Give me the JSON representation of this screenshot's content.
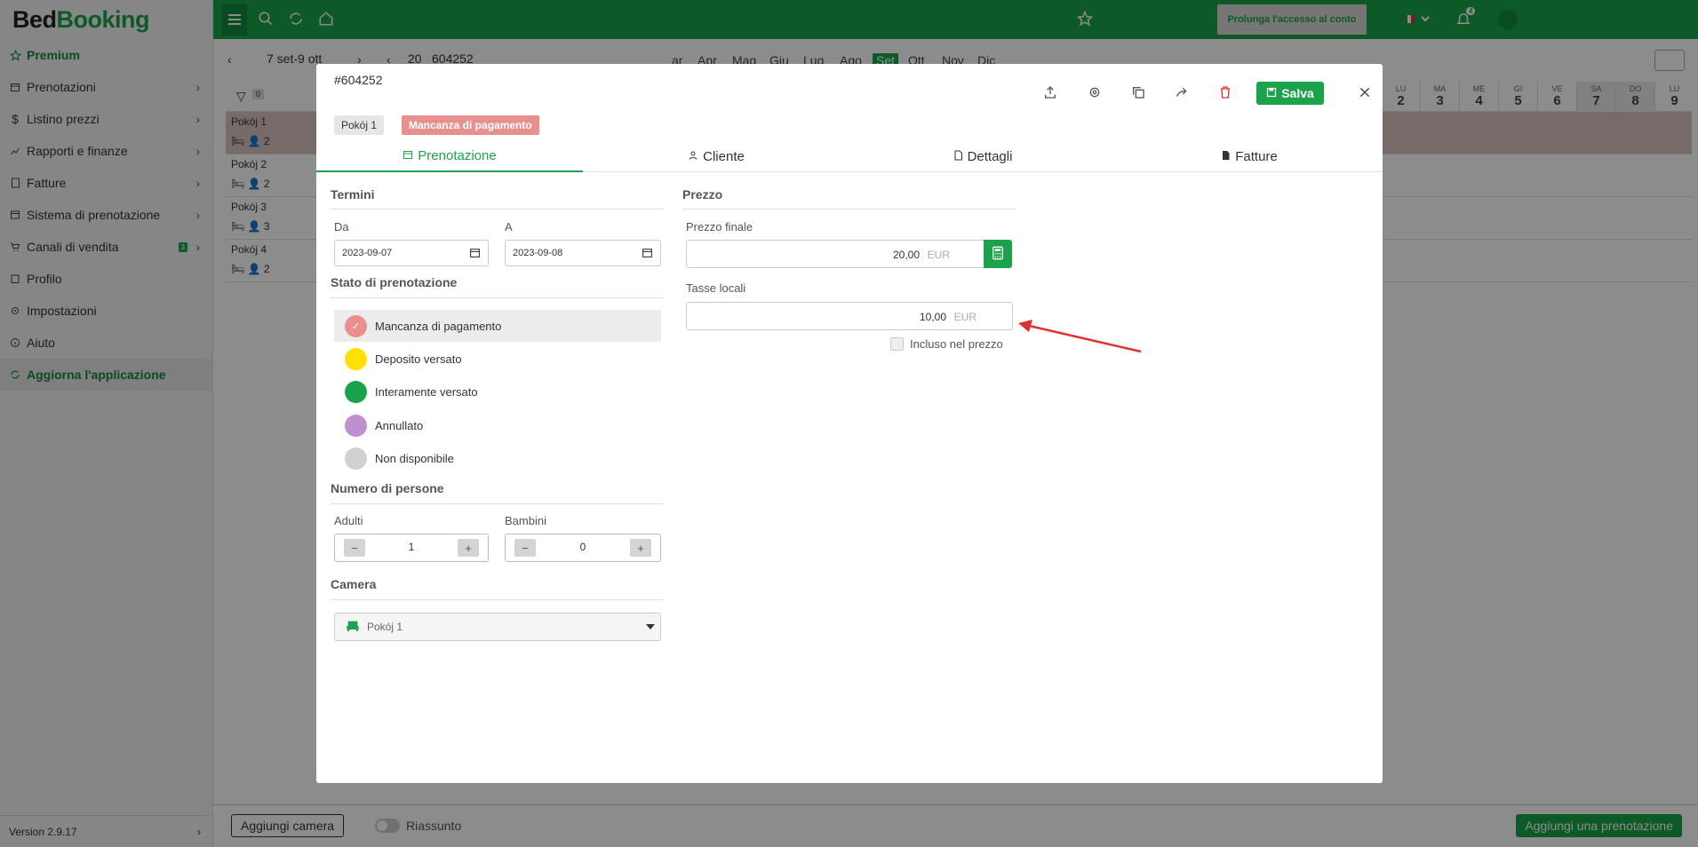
{
  "app": {
    "logo_bed": "Bed",
    "logo_booking": "Booking",
    "version": "Version 2.9.17"
  },
  "sidebar": {
    "items": [
      {
        "label": "Premium",
        "icon": "star-icon"
      },
      {
        "label": "Prenotazioni",
        "icon": "calendar-icon"
      },
      {
        "label": "Listino prezzi",
        "icon": "dollar-icon"
      },
      {
        "label": "Rapporti e finanze",
        "icon": "chart-icon"
      },
      {
        "label": "Fatture",
        "icon": "invoice-icon"
      },
      {
        "label": "Sistema di prenotazione",
        "icon": "window-icon"
      },
      {
        "label": "Canali di vendita",
        "icon": "cart-icon",
        "badge": "3"
      },
      {
        "label": "Profilo",
        "icon": "building-icon"
      },
      {
        "label": "Impostazioni",
        "icon": "gear-icon"
      },
      {
        "label": "Aiuto",
        "icon": "info-icon"
      },
      {
        "label": "Aggiorna l'applicazione",
        "icon": "refresh-icon"
      }
    ]
  },
  "topbar": {
    "prolunga": "Prolunga l'accesso al conto",
    "notif_count": "4"
  },
  "calendar": {
    "range": "7 set-9 ott",
    "year_prefix": "20",
    "months": [
      "ar",
      "Apr",
      "Mag",
      "Giu",
      "Lug",
      "Ago",
      "Set",
      "Ott",
      "Nov",
      "Dic"
    ],
    "active_month": "Set",
    "filter_count": "0",
    "days": [
      {
        "dn": "LU",
        "dd": "2"
      },
      {
        "dn": "MA",
        "dd": "3"
      },
      {
        "dn": "ME",
        "dd": "4"
      },
      {
        "dn": "GI",
        "dd": "5"
      },
      {
        "dn": "VE",
        "dd": "6"
      },
      {
        "dn": "SA",
        "dd": "7"
      },
      {
        "dn": "DO",
        "dd": "8"
      },
      {
        "dn": "LU",
        "dd": "9"
      }
    ],
    "rooms": [
      {
        "name": "Pokój 1",
        "cap": "2"
      },
      {
        "name": "Pokój 2",
        "cap": "2"
      },
      {
        "name": "Pokój 3",
        "cap": "3"
      },
      {
        "name": "Pokój 4",
        "cap": "2"
      }
    ]
  },
  "footer": {
    "add_room": "Aggiungi camera",
    "summary": "Riassunto",
    "add_booking": "Aggiungi una prenotazione"
  },
  "modal": {
    "booking_id": "#604252",
    "bg_booking_id": "604252",
    "room_chip": "Pokój 1",
    "status_chip": "Mancanza di pagamento",
    "save_label": "Salva",
    "tabs": [
      {
        "label": "Prenotazione",
        "icon": "calendar-icon"
      },
      {
        "label": "Cliente",
        "icon": "user-icon"
      },
      {
        "label": "Dettagli",
        "icon": "document-icon"
      },
      {
        "label": "Fatture",
        "icon": "invoice-icon"
      }
    ],
    "terms": {
      "title": "Termini",
      "from_label": "Da",
      "from_value": "2023-09-07",
      "to_label": "A",
      "to_value": "2023-09-08"
    },
    "status": {
      "title": "Stato di prenotazione",
      "options": [
        {
          "label": "Mancanza di pagamento",
          "color": "#e8908e",
          "selected": true
        },
        {
          "label": "Deposito versato",
          "color": "#ffe000"
        },
        {
          "label": "Interamente versato",
          "color": "#1aa34a"
        },
        {
          "label": "Annullato",
          "color": "#c08fd0"
        },
        {
          "label": "Non disponibile",
          "color": "#d0d0d0"
        }
      ]
    },
    "persons": {
      "title": "Numero di persone",
      "adults_label": "Adulti",
      "adults_value": "1",
      "children_label": "Bambini",
      "children_value": "0"
    },
    "room": {
      "title": "Camera",
      "value": "Pokój 1"
    },
    "price": {
      "title": "Prezzo",
      "final_label": "Prezzo finale",
      "final_value": "20,00",
      "currency": "EUR",
      "tax_label": "Tasse locali",
      "tax_value": "10,00",
      "included_label": "Incluso nel prezzo"
    }
  }
}
